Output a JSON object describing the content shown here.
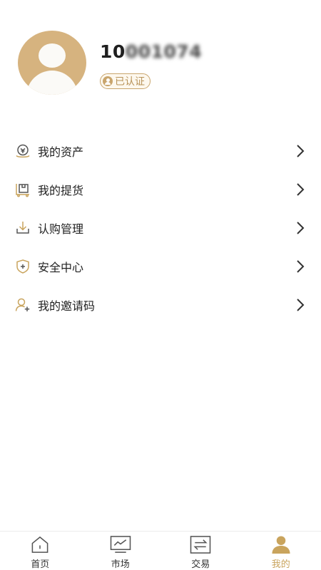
{
  "profile": {
    "user_id_prefix": "10",
    "user_id_masked": "001074",
    "verified_label": "已认证"
  },
  "menu": {
    "items": [
      {
        "label": "我的资产",
        "icon": "asset-icon"
      },
      {
        "label": "我的提货",
        "icon": "pickup-icon"
      },
      {
        "label": "认购管理",
        "icon": "subscription-icon"
      },
      {
        "label": "安全中心",
        "icon": "shield-icon"
      },
      {
        "label": "我的邀请码",
        "icon": "invite-user-icon"
      }
    ]
  },
  "tabbar": {
    "items": [
      {
        "label": "首页",
        "icon": "home-icon",
        "active": false
      },
      {
        "label": "市场",
        "icon": "market-chart-icon",
        "active": false
      },
      {
        "label": "交易",
        "icon": "exchange-icon",
        "active": false
      },
      {
        "label": "我的",
        "icon": "user-icon",
        "active": true
      }
    ]
  },
  "colors": {
    "accent_gold": "#c9a45d",
    "avatar_bg": "#d6b37f",
    "icon_gray": "#555555"
  }
}
